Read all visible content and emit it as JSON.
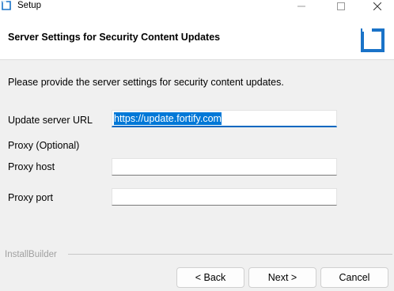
{
  "window": {
    "title": "Setup",
    "controls": {
      "minimize": "minimize-icon",
      "maximize": "maximize-icon",
      "close": "close-icon"
    }
  },
  "header": {
    "title": "Server Settings for Security Content Updates",
    "logo": "installbuilder-logo-icon"
  },
  "body": {
    "intro": "Please provide the server settings for security content updates.",
    "fields": {
      "update_url": {
        "label": "Update server URL",
        "value": "https://update.fortify.com"
      },
      "proxy_section": "Proxy (Optional)",
      "proxy_host": {
        "label": "Proxy host",
        "value": ""
      },
      "proxy_port": {
        "label": "Proxy port",
        "value": ""
      }
    }
  },
  "footer": {
    "brand": "InstallBuilder",
    "buttons": {
      "back": "< Back",
      "next": "Next >",
      "cancel": "Cancel"
    }
  },
  "colors": {
    "accent": "#0067c0",
    "selection": "#0078d7",
    "logo": "#1a73c8"
  }
}
